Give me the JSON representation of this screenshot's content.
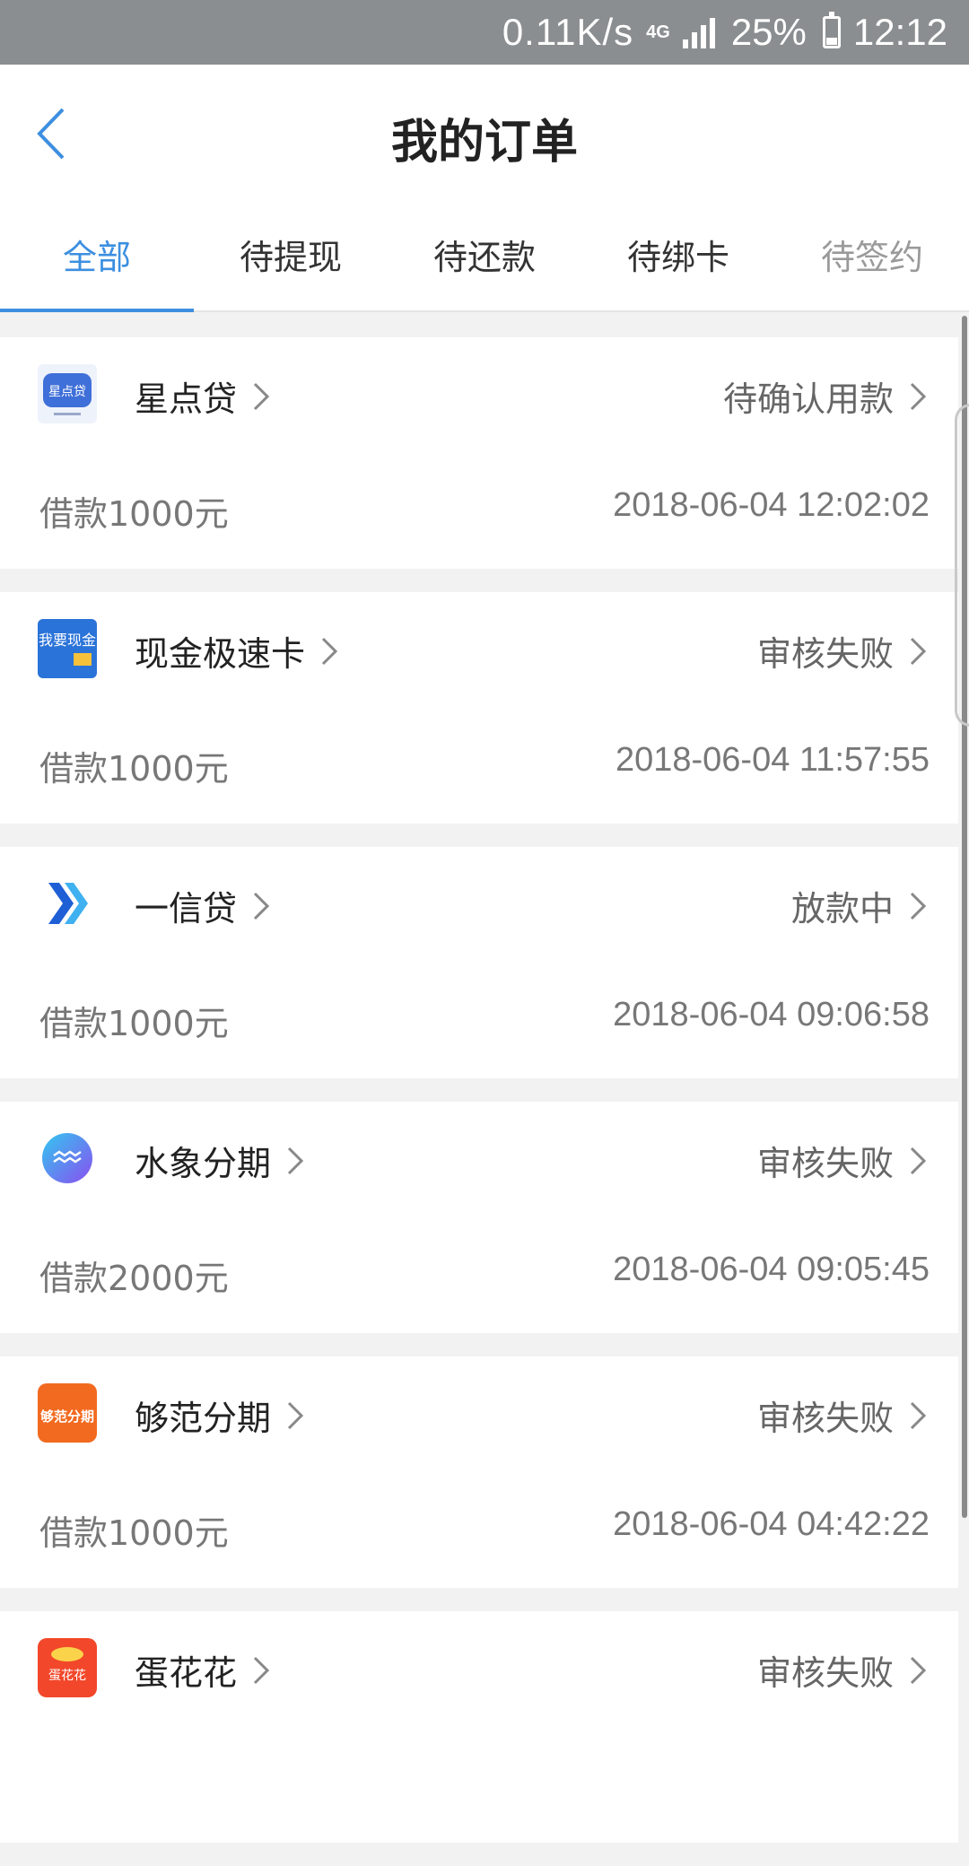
{
  "status_bar": {
    "net_speed": "0.11K/s",
    "network": "4G",
    "battery": "25%",
    "time": "12:12"
  },
  "header": {
    "title": "我的订单"
  },
  "tabs": [
    {
      "label": "全部",
      "active": true
    },
    {
      "label": "待提现",
      "active": false
    },
    {
      "label": "待还款",
      "active": false
    },
    {
      "label": "待绑卡",
      "active": false
    },
    {
      "label": "待签约",
      "active": false
    }
  ],
  "orders": [
    {
      "name": "星点贷",
      "logo_text": "星点贷",
      "status": "待确认用款",
      "amount": "借款1000元",
      "time": "2018-06-04 12:02:02"
    },
    {
      "name": "现金极速卡",
      "logo_text": "我要现金",
      "status": "审核失败",
      "amount": "借款1000元",
      "time": "2018-06-04 11:57:55"
    },
    {
      "name": "一信贷",
      "logo_text": "",
      "status": "放款中",
      "amount": "借款1000元",
      "time": "2018-06-04 09:06:58"
    },
    {
      "name": "水象分期",
      "logo_text": "",
      "status": "审核失败",
      "amount": "借款2000元",
      "time": "2018-06-04 09:05:45"
    },
    {
      "name": "够范分期",
      "logo_text": "够范分期",
      "status": "审核失败",
      "amount": "借款1000元",
      "time": "2018-06-04 04:42:22"
    },
    {
      "name": "蛋花花",
      "logo_text": "蛋花花",
      "status": "审核失败",
      "amount": "",
      "time": ""
    }
  ],
  "colors": {
    "accent": "#3d8fe0",
    "status_bar": "#8b8e90"
  }
}
